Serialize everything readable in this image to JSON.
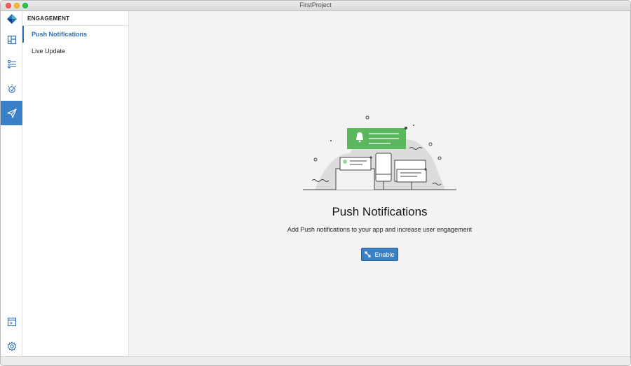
{
  "window": {
    "title": "FirstProject"
  },
  "iconbar": {
    "items": [
      {
        "icon": "logo-icon"
      },
      {
        "icon": "dashboard-icon"
      },
      {
        "icon": "settings-sliders-icon"
      },
      {
        "icon": "bulb-icon"
      },
      {
        "icon": "send-icon",
        "active": true
      },
      {
        "icon": "terminal-icon"
      },
      {
        "icon": "gear-icon"
      }
    ]
  },
  "subnav": {
    "header": "ENGAGEMENT",
    "items": [
      {
        "label": "Push Notifications",
        "active": true
      },
      {
        "label": "Live Update"
      }
    ]
  },
  "main": {
    "illustration_icon": "push-devices-illustration",
    "title": "Push Notifications",
    "description": "Add Push notifications to your app and increase user engagement",
    "enable_label": "Enable"
  },
  "colors": {
    "accent": "#3a80c9",
    "notification_green": "#5cb85c",
    "logo_blue": "#1f70c1",
    "logo_teal": "#4fb4a0"
  }
}
